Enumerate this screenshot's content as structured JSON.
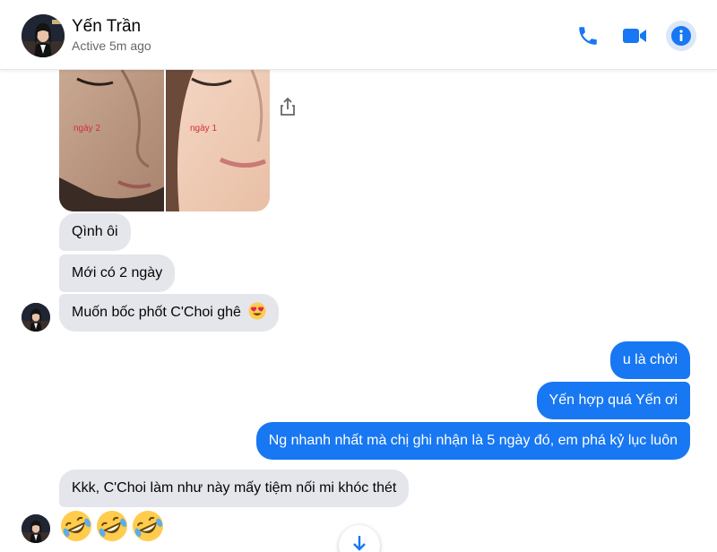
{
  "header": {
    "name": "Yến Trần",
    "status": "Active 5m ago",
    "icons": {
      "call": "phone-icon",
      "video": "video-camera-icon",
      "info": "info-icon"
    },
    "accent": "#1877f2"
  },
  "photo": {
    "labels": [
      "ngày 2",
      "ngày 1"
    ]
  },
  "messages": {
    "m1": "Qình ôi",
    "m2": "Mới có 2 ngày",
    "m3": "Muốn bốc phốt C'Choi ghê",
    "m4": "u là chời",
    "m5": "Yến hợp quá Yến ơi",
    "m6": "Ng nhanh nhất mà chị ghi nhận là 5 ngày đó, em phá kỷ lục luôn",
    "m7": "Kkk, C'Choi làm như này mấy tiệm nối mi khóc thét"
  },
  "reactions": {
    "heart_eyes": "heart-eyes-emoji",
    "laughing": "rolling-on-floor-laughing-emoji"
  },
  "colors": {
    "incoming": "#e4e6eb",
    "outgoing": "#1877f2"
  }
}
